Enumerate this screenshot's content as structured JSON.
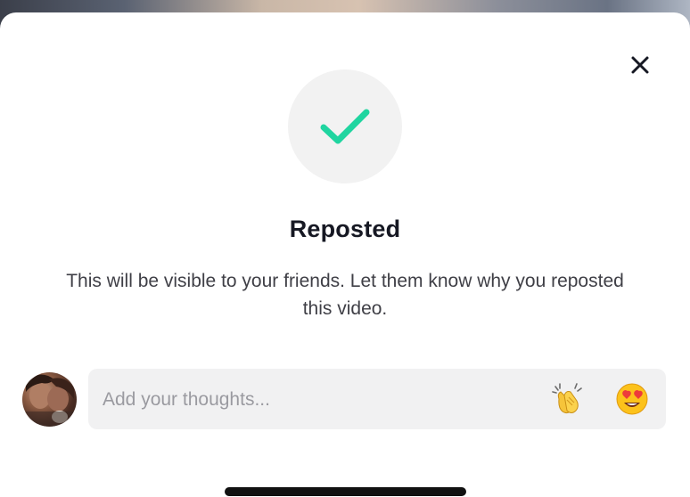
{
  "sheet": {
    "title": "Reposted",
    "description": "This will be visible to your friends. Let them know why you reposted this video.",
    "close_icon": "close-icon",
    "status_icon": "checkmark-icon"
  },
  "comment": {
    "placeholder": "Add your thoughts...",
    "value": "",
    "emoji_buttons": [
      "clapping-hands-emoji",
      "heart-eyes-emoji"
    ]
  },
  "colors": {
    "check_accent": "#20d5a0",
    "title": "#161823",
    "input_bg": "#f1f1f2"
  }
}
